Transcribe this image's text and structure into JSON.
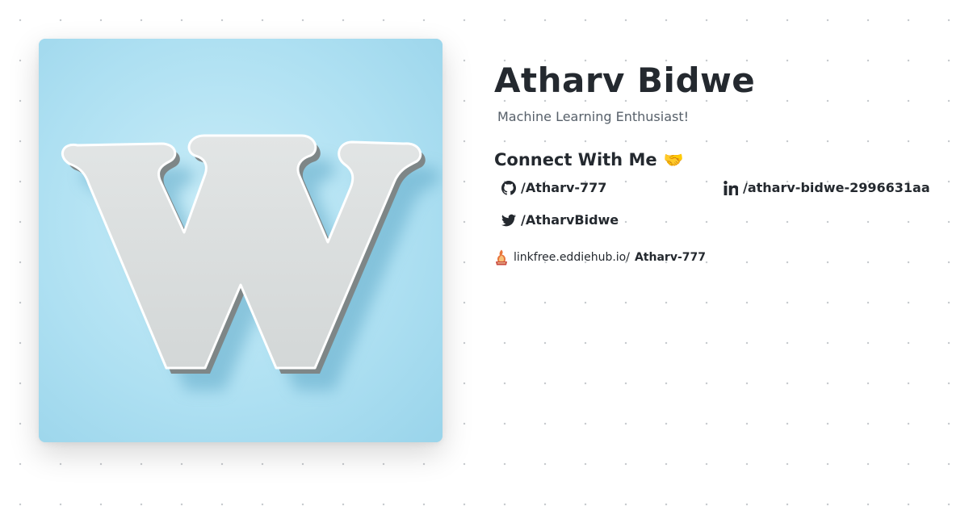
{
  "profile": {
    "name": "Atharv Bidwe",
    "tagline": "Machine Learning Enthusiast!",
    "avatar_letter": "W"
  },
  "connect": {
    "heading": "Connect With Me",
    "emoji": "🤝"
  },
  "social": {
    "github": {
      "label": "/Atharv-777",
      "icon": "github-icon"
    },
    "linkedin": {
      "label": "/atharv-bidwe-2996631aa",
      "icon": "linkedin-icon"
    },
    "twitter": {
      "label": "/AtharvBidwe",
      "icon": "twitter-icon"
    }
  },
  "linkfree": {
    "domain": "linkfree.eddiehub.io/",
    "username": "Atharv-777",
    "icon": "linkfree-logo-icon"
  },
  "colors": {
    "background": "#ffffff",
    "dot_grid": "#c6c9cd",
    "avatar_bg": "#acdff1",
    "text_primary": "#24292f",
    "text_secondary": "#57606a"
  }
}
